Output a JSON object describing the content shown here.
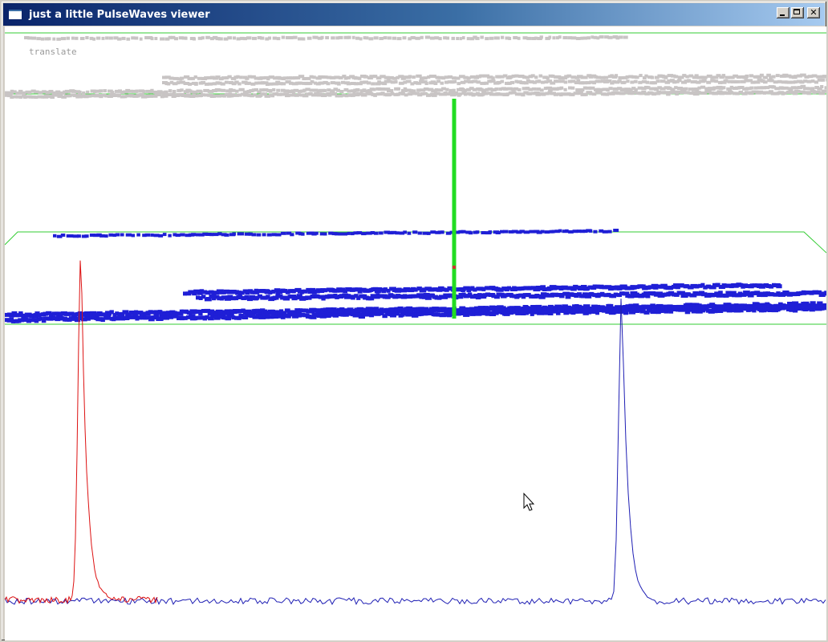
{
  "window": {
    "title": "just a little PulseWaves viewer",
    "icon": "app-window-icon"
  },
  "controls": {
    "minimize_icon": "minimize-icon",
    "maximize_icon": "maximize-icon",
    "close_icon": "close-icon",
    "close_glyph": "✕"
  },
  "viewport": {
    "mode_label": "translate",
    "colors": {
      "background": "#ffffff",
      "bounding_box": "#33cc33",
      "selected_pulse": "#22dd22",
      "points_top": "#c8c4c4",
      "points_bottom": "#1f1fd6",
      "waveform_outgoing": "#dd1111",
      "waveform_return": "#1f1fb4"
    }
  }
}
